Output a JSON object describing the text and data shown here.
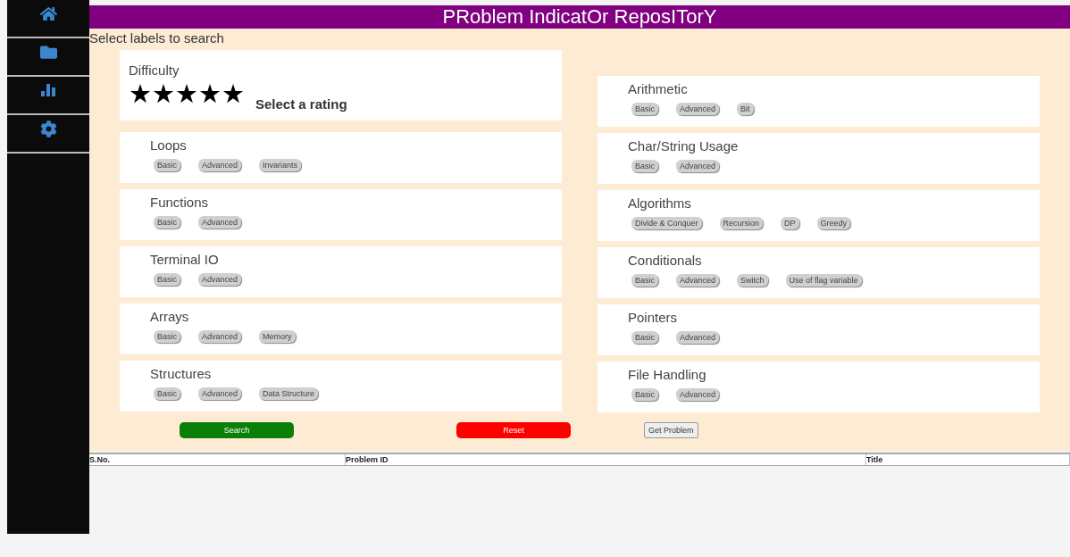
{
  "sidebar": {
    "items": [
      {
        "kind": "home"
      },
      {
        "kind": "folder"
      },
      {
        "kind": "chart"
      },
      {
        "kind": "settings"
      }
    ]
  },
  "header": {
    "title": "PRoblem IndicatOr ReposITorY"
  },
  "prompt": "Select labels to search",
  "difficulty": {
    "label": "Difficulty",
    "stars": 5,
    "hint": "Select a rating"
  },
  "left_categories": [
    {
      "name": "Loops",
      "tags": [
        "Basic",
        "Advanced",
        "Invariants"
      ]
    },
    {
      "name": "Functions",
      "tags": [
        "Basic",
        "Advanced"
      ]
    },
    {
      "name": "Terminal IO",
      "tags": [
        "Basic",
        "Advanced"
      ]
    },
    {
      "name": "Arrays",
      "tags": [
        "Basic",
        "Advanced",
        "Memory"
      ]
    },
    {
      "name": "Structures",
      "tags": [
        "Basic",
        "Advanced",
        "Data Structure"
      ]
    }
  ],
  "right_categories": [
    {
      "name": "Arithmetic",
      "tags": [
        "Basic",
        "Advanced",
        "Bit"
      ]
    },
    {
      "name": "Char/String Usage",
      "tags": [
        "Basic",
        "Advanced"
      ]
    },
    {
      "name": "Algorithms",
      "tags": [
        "Divide & Conquer",
        "Recursion",
        "DP",
        "Greedy"
      ]
    },
    {
      "name": "Conditionals",
      "tags": [
        "Basic",
        "Advanced",
        "Switch",
        "Use of flag variable"
      ]
    },
    {
      "name": "Pointers",
      "tags": [
        "Basic",
        "Advanced"
      ]
    },
    {
      "name": "File Handling",
      "tags": [
        "Basic",
        "Advanced"
      ]
    }
  ],
  "buttons": [
    {
      "kind": "search",
      "label": "Search"
    },
    {
      "kind": "reset",
      "label": "Reset"
    },
    {
      "kind": "plain",
      "label": "Get Problem"
    }
  ],
  "table": {
    "columns": [
      "S.No.",
      "Problem ID",
      "Title"
    ]
  }
}
